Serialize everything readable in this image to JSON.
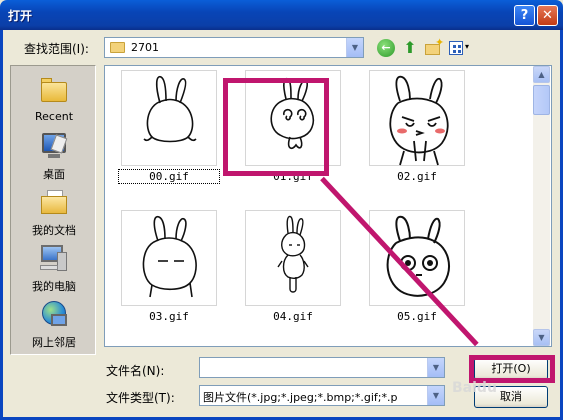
{
  "window": {
    "title": "打开",
    "help_label": "?",
    "close_label": "✕"
  },
  "lookin": {
    "label": "查找范围(I):",
    "value": "2701",
    "arrow": "▼"
  },
  "toolbar": {
    "icons": [
      "back-icon",
      "up-folder-icon",
      "new-folder-icon",
      "views-menu-icon"
    ],
    "back_glyph": "←",
    "up_glyph": "⬆",
    "views_arrow": "▾"
  },
  "places": [
    {
      "label": "Recent",
      "icon": "recent-icon"
    },
    {
      "label": "桌面",
      "icon": "desktop-icon"
    },
    {
      "label": "我的文档",
      "icon": "my-documents-icon"
    },
    {
      "label": "我的电脑",
      "icon": "my-computer-icon"
    },
    {
      "label": "网上邻居",
      "icon": "network-icon"
    }
  ],
  "files": [
    {
      "name": "00.gif",
      "selected": true
    },
    {
      "name": "01.gif",
      "selected": false
    },
    {
      "name": "02.gif",
      "selected": false
    },
    {
      "name": "03.gif",
      "selected": false
    },
    {
      "name": "04.gif",
      "selected": false
    },
    {
      "name": "05.gif",
      "selected": false
    }
  ],
  "filename": {
    "label": "文件名(N):",
    "value": "",
    "arrow": "▼"
  },
  "filetype": {
    "label": "文件类型(T):",
    "value": "图片文件(*.jpg;*.jpeg;*.bmp;*.gif;*.p",
    "arrow": "▼"
  },
  "buttons": {
    "open": "打开(O)",
    "cancel": "取消"
  },
  "scrollbar": {
    "up": "▲",
    "down": "▼"
  },
  "watermark": "Baidu",
  "colors": {
    "highlight": "#c0166e",
    "title_bar": "#0a46c0"
  }
}
